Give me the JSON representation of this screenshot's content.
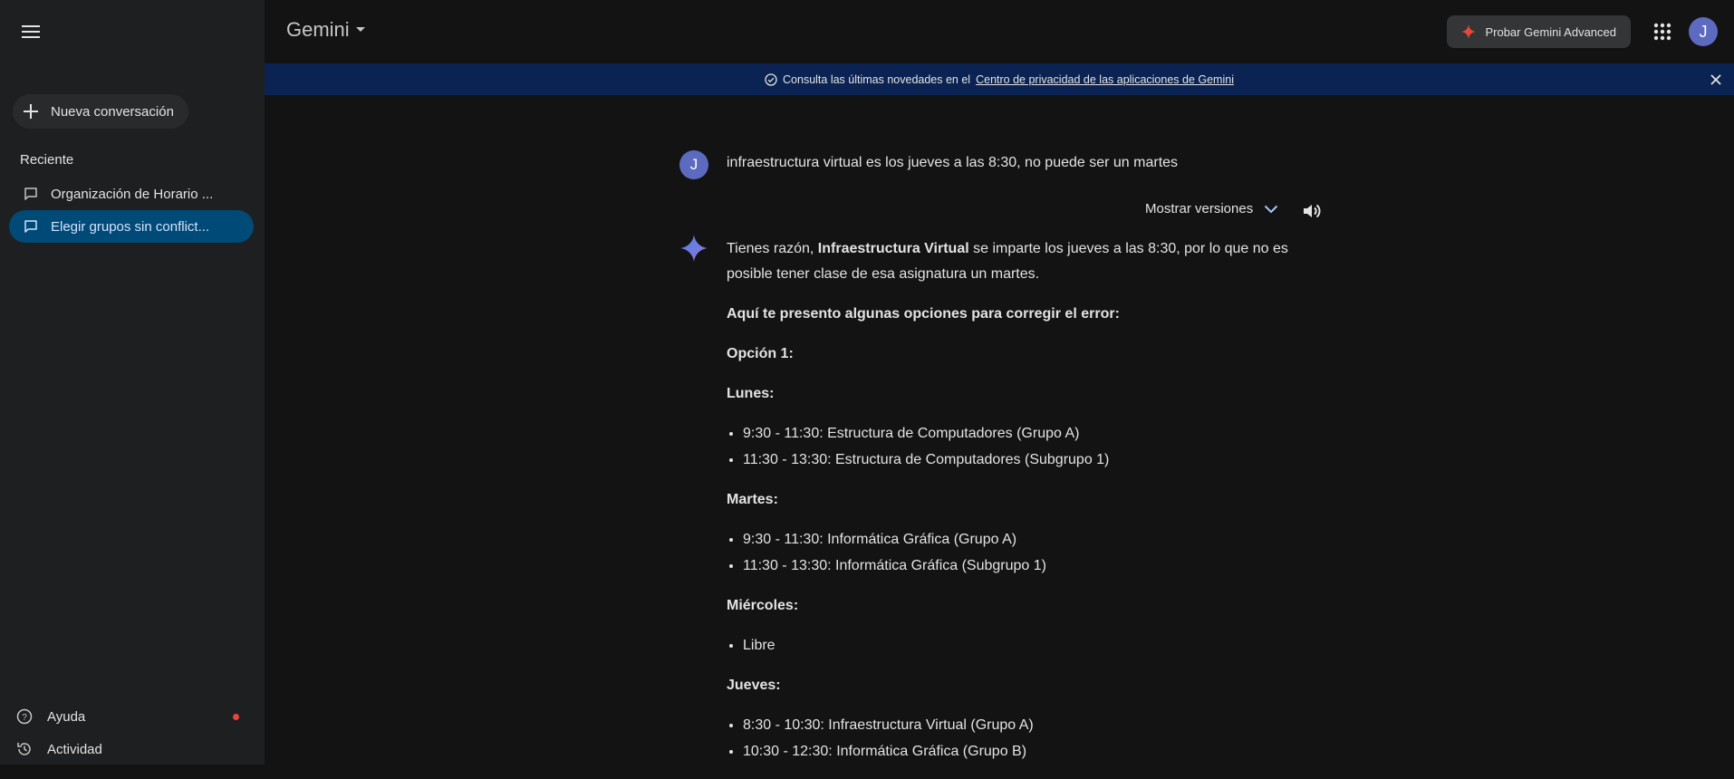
{
  "sidebar": {
    "new_chat_label": "Nueva conversación",
    "recent_label": "Reciente",
    "conversations": [
      {
        "label": "Organización de Horario ..."
      },
      {
        "label": "Elegir grupos sin conflict..."
      }
    ],
    "help_label": "Ayuda",
    "activity_label": "Actividad"
  },
  "header": {
    "model_name": "Gemini",
    "advanced_label": "Probar Gemini Advanced",
    "user_initial": "J"
  },
  "banner": {
    "text": "Consulta las últimas novedades en el",
    "link": "Centro de privacidad de las aplicaciones de Gemini"
  },
  "chat": {
    "user_initial": "J",
    "user_message": "infraestructura virtual es los jueves a las 8:30, no puede ser un martes",
    "versions_label": "Mostrar versiones",
    "intro_prefix": "Tienes razón, ",
    "intro_bold": "Infraestructura Virtual",
    "intro_suffix": " se imparte los jueves a las 8:30, por lo que no es posible tener clase de esa asignatura un martes.",
    "options_heading": "Aquí te presento algunas opciones para corregir el error:",
    "option1_heading": "Opción 1:",
    "days": [
      {
        "name": "Lunes:",
        "items": [
          "9:30 - 11:30: Estructura de Computadores (Grupo A)",
          "11:30 - 13:30: Estructura de Computadores (Subgrupo 1)"
        ]
      },
      {
        "name": "Martes:",
        "items": [
          "9:30 - 11:30: Informática Gráfica (Grupo A)",
          "11:30 - 13:30: Informática Gráfica (Subgrupo 1)"
        ]
      },
      {
        "name": "Miércoles:",
        "items": [
          "Libre"
        ]
      },
      {
        "name": "Jueves:",
        "items": [
          "8:30 - 10:30: Infraestructura Virtual (Grupo A)",
          "10:30 - 12:30: Informática Gráfica (Grupo B)"
        ]
      }
    ]
  },
  "colors": {
    "sidebar_bg": "#1e1f20",
    "main_bg": "#131314",
    "banner_bg": "#0b2352",
    "active_item_bg": "#004a77",
    "avatar_bg": "#5c6bc0",
    "alert_dot": "#e8453c"
  },
  "icons": [
    "menu-icon",
    "plus-icon",
    "chat-bubble-icon",
    "help-icon",
    "history-icon",
    "dropdown-arrow-icon",
    "sparkle-icon",
    "apps-grid-icon",
    "check-circle-icon",
    "close-icon",
    "chevron-down-icon",
    "speaker-icon",
    "gemini-star-icon"
  ]
}
